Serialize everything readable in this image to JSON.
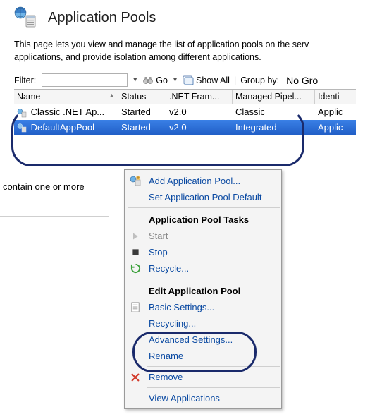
{
  "header": {
    "title": "Application Pools"
  },
  "intro": "This page lets you view and manage the list of application pools on the serv applications, and provide isolation among different applications.",
  "toolbar": {
    "filter_label": "Filter:",
    "filter_value": "",
    "go_label": "Go",
    "show_all_label": "Show All",
    "group_by_label": "Group by:",
    "group_by_value": "No Gro"
  },
  "grid": {
    "columns": [
      "Name",
      "Status",
      ".NET Fram...",
      "Managed Pipel...",
      "Identi"
    ],
    "rows": [
      {
        "name": "Classic .NET Ap...",
        "status": "Started",
        "net": "v2.0",
        "pipe": "Classic",
        "ident": "Applic",
        "selected": false
      },
      {
        "name": "DefaultAppPool",
        "status": "Started",
        "net": "v2.0",
        "pipe": "Integrated",
        "ident": "Applic",
        "selected": true
      }
    ]
  },
  "below_text": "contain one or more",
  "context_menu": {
    "add_pool": "Add Application Pool...",
    "set_defaults": "Set Application Pool Default",
    "tasks_heading": "Application Pool Tasks",
    "start": "Start",
    "stop": "Stop",
    "recycle": "Recycle...",
    "edit_heading": "Edit Application Pool",
    "basic": "Basic Settings...",
    "recycling": "Recycling...",
    "advanced": "Advanced Settings...",
    "rename": "Rename",
    "remove": "Remove",
    "view_apps": "View Applications"
  }
}
